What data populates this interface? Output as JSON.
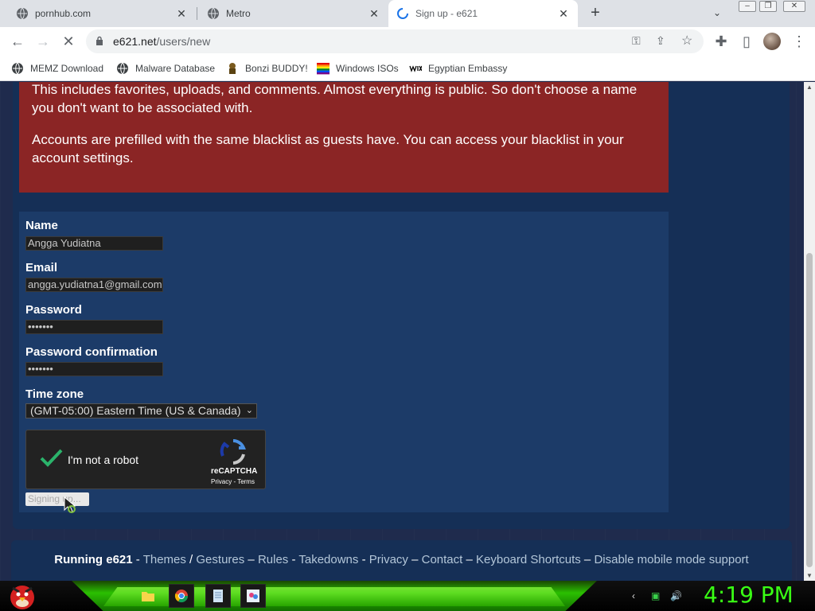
{
  "browser": {
    "tabs": [
      {
        "title": "pornhub.com",
        "active": false,
        "loading": false
      },
      {
        "title": "Metro",
        "active": false,
        "loading": false
      },
      {
        "title": "Sign up - e621",
        "active": true,
        "loading": true
      }
    ],
    "new_tab_glyph": "+",
    "url_host": "e621.net",
    "url_path": "/users/new",
    "bookmarks": [
      {
        "label": "MEMZ Download",
        "icon": "globe-icon"
      },
      {
        "label": "Malware Database",
        "icon": "globe-icon"
      },
      {
        "label": "Bonzi BUDDY!",
        "icon": "bonzi-icon"
      },
      {
        "label": "Windows ISOs",
        "icon": "rainbow-flag-icon"
      },
      {
        "label": "Egyptian Embassy",
        "icon": "wix-icon"
      }
    ]
  },
  "notice": {
    "paragraph1": "This includes favorites, uploads, and comments. Almost everything is public. So don't choose a name you don't want to be associated with.",
    "paragraph2": "Accounts are prefilled with the same blacklist as guests have. You can access your blacklist in your account settings."
  },
  "form": {
    "name_label": "Name",
    "name_value": "Angga Yudiatna",
    "email_label": "Email",
    "email_value": "angga.yudiatna1@gmail.com",
    "password_label": "Password",
    "password_value": "•••••••",
    "password_confirm_label": "Password confirmation",
    "password_confirm_value": "•••••••",
    "timezone_label": "Time zone",
    "timezone_value": "(GMT-05:00) Eastern Time (US & Canada)",
    "captcha_text": "I'm not a robot",
    "captcha_brand": "reCAPTCHA",
    "captcha_links": "Privacy - Terms",
    "submit_label": "Signing up..."
  },
  "footer": {
    "running": "Running e621",
    "links": [
      "Themes",
      "Gestures",
      "Rules",
      "Takedowns",
      "Privacy",
      "Contact",
      "Keyboard Shortcuts",
      "Disable mobile mode support"
    ],
    "separators": [
      " - ",
      " / ",
      " – ",
      " - ",
      " - ",
      " – ",
      " – ",
      " – "
    ]
  },
  "taskbar": {
    "clock": "4:19 PM"
  },
  "colors": {
    "notice_bg": "#8b2525",
    "form_bg": "#1c3b68",
    "page_bg": "#1f2b4d",
    "link": "#b4c7d9",
    "clock": "#39ff14"
  }
}
